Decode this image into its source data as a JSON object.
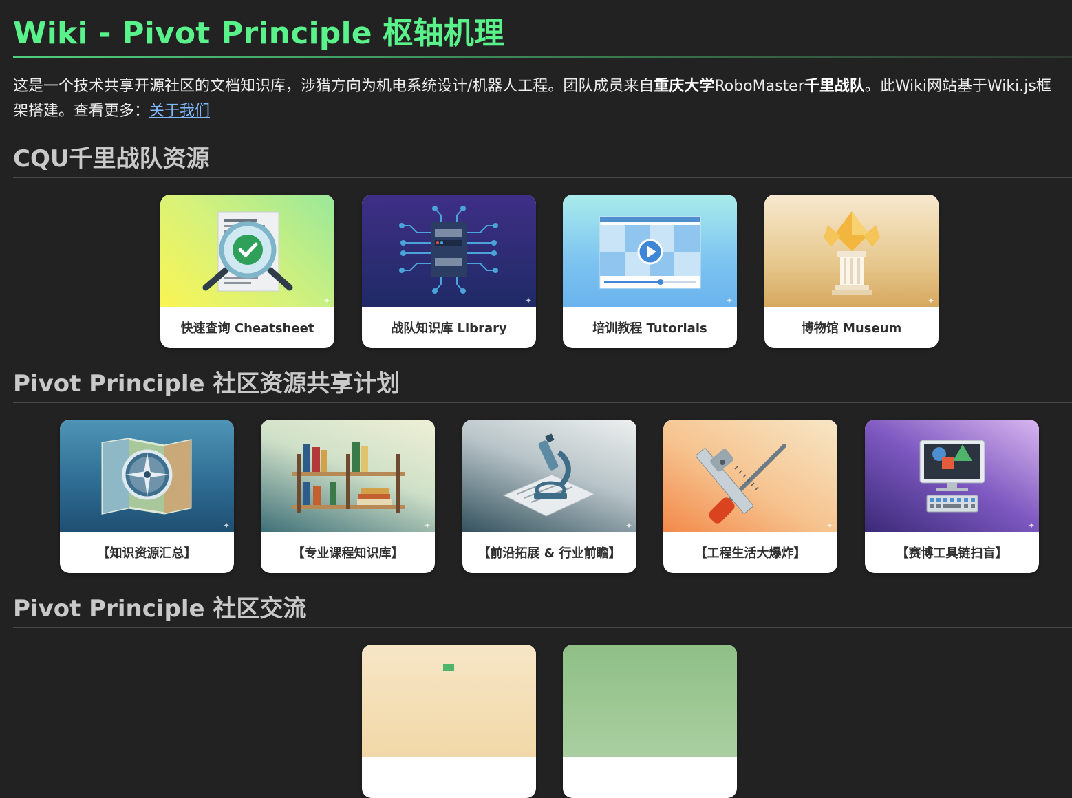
{
  "title": "Wiki - Pivot Principle 枢轴机理",
  "intro": {
    "part1": "这是一个技术共享开源社区的文档知识库，涉猎方向为机电系统设计/机器人工程。团队成员来自",
    "bold1": "重庆大学",
    "part2": "RoboMaster",
    "bold2": "千里战队",
    "part3": "。此Wiki网站基于Wiki.js框架搭建。查看更多：",
    "link": "关于我们"
  },
  "sections": [
    {
      "heading": "CQU千里战队资源",
      "cards": [
        {
          "label": "快速查询 Cheatsheet",
          "icon": "magnifier-checklist-icon"
        },
        {
          "label": "战队知识库 Library",
          "icon": "server-circuit-icon"
        },
        {
          "label": "培训教程 Tutorials",
          "icon": "video-player-icon"
        },
        {
          "label": "博物馆 Museum",
          "icon": "trophy-pillar-icon"
        }
      ]
    },
    {
      "heading": "Pivot Principle 社区资源共享计划",
      "cards": [
        {
          "label": "【知识资源汇总】",
          "icon": "map-compass-icon"
        },
        {
          "label": "【专业课程知识库】",
          "icon": "bookshelf-icon"
        },
        {
          "label": "【前沿拓展 & 行业前瞻】",
          "icon": "microscope-icon"
        },
        {
          "label": "【工程生活大爆炸】",
          "icon": "tools-icon"
        },
        {
          "label": "【赛博工具链扫盲】",
          "icon": "computer-icon"
        }
      ]
    },
    {
      "heading": "Pivot Principle 社区交流",
      "cards": [
        {
          "label": "",
          "icon": "community-icon"
        },
        {
          "label": "",
          "icon": "community-icon"
        }
      ]
    }
  ],
  "colors": {
    "title": "#5af28a",
    "background": "#222222",
    "link": "#7fb9ff"
  }
}
